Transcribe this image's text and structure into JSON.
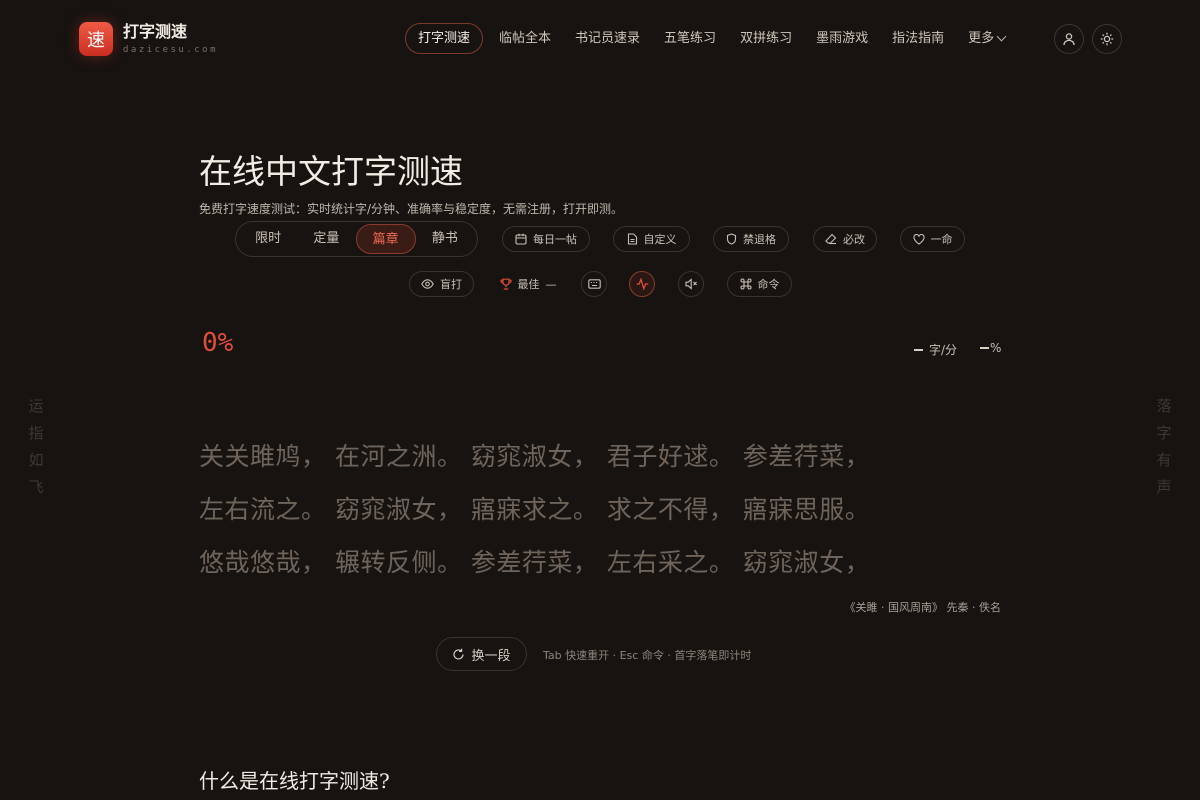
{
  "brand": {
    "logo_char": "速",
    "name": "打字测速",
    "domain": "dazicesu.com",
    "accent": "#e24d37"
  },
  "nav": {
    "items": [
      "打字测速",
      "临帖全本",
      "书记员速录",
      "五笔练习",
      "双拼练习",
      "墨雨游戏",
      "指法指南"
    ],
    "more": "更多"
  },
  "hero": {
    "title": "在线中文打字测速",
    "subtitle": "免费打字速度测试：实时统计字/分钟、准确率与稳定度，无需注册，打开即测。"
  },
  "modes": {
    "tabs": [
      "限时",
      "定量",
      "篇章",
      "静书"
    ],
    "active": "篇章"
  },
  "options": {
    "daily": "每日一帖",
    "custom": "自定义",
    "no_backspace": "禁退格",
    "must_fix": "必改",
    "one_life": "一命",
    "blind": "盲打",
    "best_label": "最佳",
    "best_value": "—",
    "command": "命令"
  },
  "stats": {
    "progress": "0%",
    "speed_unit": "字/分",
    "accuracy_unit": "%"
  },
  "side": {
    "left": [
      "运",
      "指",
      "如",
      "飞"
    ],
    "right": [
      "落",
      "字",
      "有",
      "声"
    ]
  },
  "passage": {
    "lines": [
      "关关雎鸠， 在河之洲。 窈窕淑女， 君子好逑。 参差荇菜，",
      "左右流之。 窈窕淑女， 寤寐求之。 求之不得， 寤寐思服。",
      "悠哉悠哉， 辗转反侧。 参差荇菜， 左右采之。 窈窕淑女，"
    ],
    "source": "《关雎 · 国风周南》 先秦 · 佚名"
  },
  "actions": {
    "next": "换一段",
    "hint": "Tab 快速重开 · Esc 命令 · 首字落笔即计时"
  },
  "faq": {
    "title": "什么是在线打字测速?"
  }
}
